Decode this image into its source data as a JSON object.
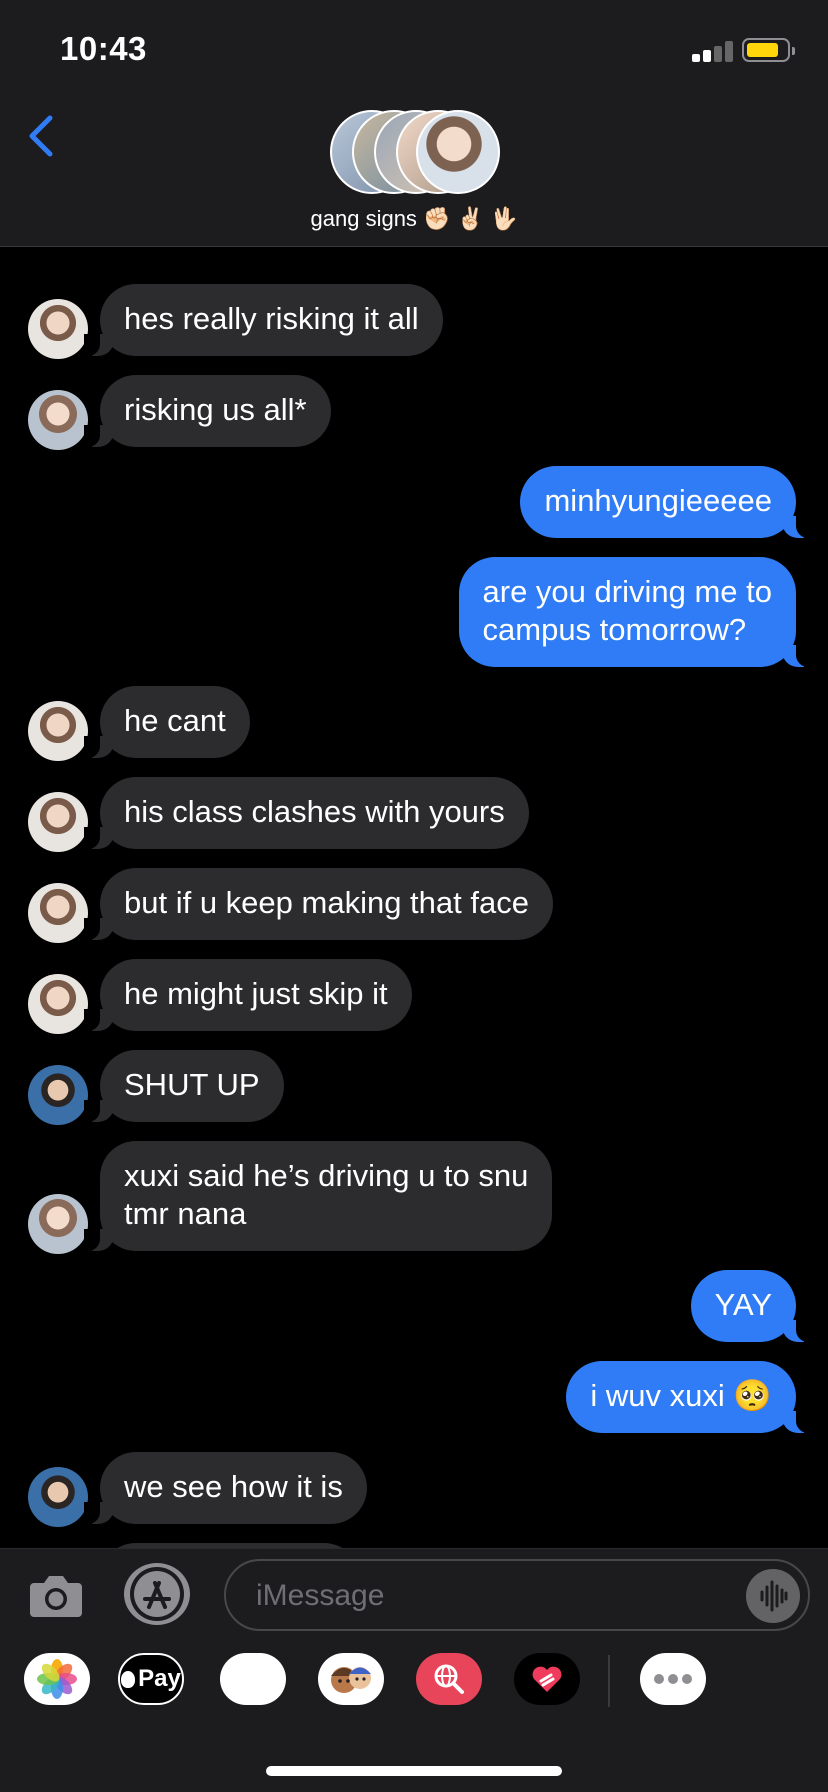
{
  "status_bar": {
    "time": "10:43"
  },
  "header": {
    "group_name": "gang signs",
    "group_emojis": "✊🏻 ✌🏻 🖖🏻"
  },
  "messages": [
    {
      "side": "in",
      "text": "hes really risking it all",
      "sender": "a"
    },
    {
      "side": "in",
      "text": "risking us all*",
      "sender": "b"
    },
    {
      "side": "out",
      "text": "minhyungieeeee"
    },
    {
      "side": "out",
      "text": "are you driving me to\ncampus tomorrow?"
    },
    {
      "side": "in",
      "text": "he cant",
      "sender": "a"
    },
    {
      "side": "in",
      "text": "his class clashes with yours",
      "sender": "a"
    },
    {
      "side": "in",
      "text": "but if u keep making that face",
      "sender": "a"
    },
    {
      "side": "in",
      "text": "he might just skip it",
      "sender": "a"
    },
    {
      "side": "in",
      "text": "SHUT UP",
      "sender": "c"
    },
    {
      "side": "in",
      "text": "xuxi said he’s driving u to snu\ntmr nana",
      "sender": "b"
    },
    {
      "side": "out",
      "text": "YAY"
    },
    {
      "side": "out",
      "text": "i wuv xuxi 🥺"
    },
    {
      "side": "in",
      "text": "we see how it is",
      "sender": "c"
    }
  ],
  "composer": {
    "placeholder": "iMessage"
  },
  "app_drawer": {
    "items": [
      {
        "name": "photos-app",
        "label": ""
      },
      {
        "name": "apple-pay-app",
        "label": "Pay"
      },
      {
        "name": "animoji-app",
        "label": "🐵"
      },
      {
        "name": "memoji-app",
        "label": ""
      },
      {
        "name": "web-images-app",
        "label": ""
      },
      {
        "name": "digital-touch-app",
        "label": ""
      },
      {
        "name": "more-apps",
        "label": ""
      }
    ]
  },
  "colors": {
    "incoming_bubble": "#2c2c2e",
    "outgoing_bubble": "#2f7cf6",
    "background": "#000000",
    "header": "#1c1c1e"
  }
}
